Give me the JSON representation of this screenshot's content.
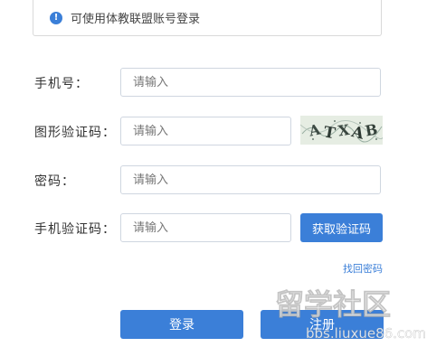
{
  "notice": {
    "icon": "info-icon",
    "text": "可使用体教联盟账号登录"
  },
  "form": {
    "phone": {
      "label": "手机号：",
      "placeholder": "请输入",
      "value": ""
    },
    "captcha": {
      "label": "图形验证码：",
      "placeholder": "请输入",
      "value": "",
      "image_text": "ATXAB"
    },
    "password": {
      "label": "密码：",
      "placeholder": "请输入",
      "value": ""
    },
    "sms_code": {
      "label": "手机验证码：",
      "placeholder": "请输入",
      "value": "",
      "button_label": "获取验证码"
    }
  },
  "forgot_password": "找回密码",
  "actions": {
    "login_label": "登录",
    "register_label": "注册"
  },
  "watermark": {
    "logo_text": "留学社区",
    "url": "bbs.liuxue86.com"
  },
  "colors": {
    "accent": "#3b7fd8",
    "border": "#cfd6e0",
    "text": "#333333"
  }
}
